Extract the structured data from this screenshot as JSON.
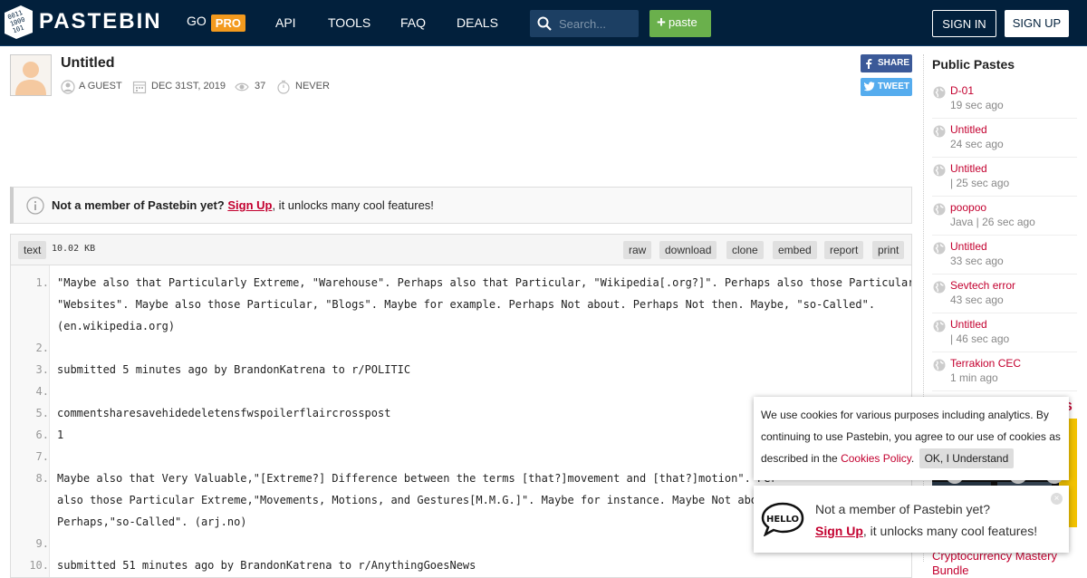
{
  "header": {
    "brand": "PASTEBIN",
    "nav": {
      "go": "GO",
      "pro": "PRO",
      "api": "API",
      "tools": "TOOLS",
      "faq": "FAQ",
      "deals": "DEALS"
    },
    "search_placeholder": "Search...",
    "paste_label": "paste",
    "sign_in": "SIGN IN",
    "sign_up": "SIGN UP"
  },
  "paste": {
    "title": "Untitled",
    "author": "A GUEST",
    "date": "DEC 31ST, 2019",
    "views": "37",
    "expires": "NEVER",
    "share": "SHARE",
    "tweet": "TWEET"
  },
  "notice": {
    "lead": "Not a member of Pastebin yet?",
    "link": "Sign Up",
    "rest": ", it unlocks many cool features!"
  },
  "code": {
    "syntax": "text",
    "size": "10.02 KB",
    "actions": [
      "raw",
      "download",
      "clone",
      "embed",
      "report",
      "print"
    ],
    "lines": [
      {
        "n": "1.",
        "text": "\"Maybe also that Particularly Extreme, \"Warehouse\". Perhaps also that Particular, \"Wikipedia[.org?]\". Perhaps also those Particular,"
      },
      {
        "n": "",
        "text": "\"Websites\". Maybe also those Particular, \"Blogs\". Maybe for example. Perhaps Not about. Perhaps Not then. Maybe, \"so-Called\"."
      },
      {
        "n": "",
        "text": "(en.wikipedia.org)"
      },
      {
        "n": "2.",
        "text": ""
      },
      {
        "n": "3.",
        "text": "submitted 5 minutes ago by BrandonKatrena to r/POLITIC"
      },
      {
        "n": "4.",
        "text": ""
      },
      {
        "n": "5.",
        "text": "commentsharesavehidedeletensfwspoilerflaircrosspost"
      },
      {
        "n": "6.",
        "text": "1"
      },
      {
        "n": "7.",
        "text": ""
      },
      {
        "n": "8.",
        "text": "Maybe also that Very Valuable,\"[Extreme?] Difference between the terms [that?]movement and [that?]motion\". Per"
      },
      {
        "n": "",
        "text": "also those Particular Extreme,\"Movements, Motions, and Gestures[M.M.G.]\". Maybe for instance. Maybe Not about."
      },
      {
        "n": "",
        "text": "Perhaps,\"so-Called\". (arj.no)"
      },
      {
        "n": "9.",
        "text": ""
      },
      {
        "n": "10.",
        "text": "submitted 51 minutes ago by BrandonKatrena to r/AnythingGoesNews"
      }
    ]
  },
  "sidebar": {
    "title": "Public Pastes",
    "items": [
      {
        "title": "D-01",
        "sub": "19 sec ago"
      },
      {
        "title": "Untitled",
        "sub": "24 sec ago"
      },
      {
        "title": "Untitled",
        "sub": "| 25 sec ago"
      },
      {
        "title": "poopoo",
        "sub": "Java | 26 sec ago"
      },
      {
        "title": "Untitled",
        "sub": "33 sec ago"
      },
      {
        "title": "Sevtech error",
        "sub": "43 sec ago"
      },
      {
        "title": "Untitled",
        "sub": "| 46 sec ago"
      },
      {
        "title": "Terrakion CEC",
        "sub": "1 min ago"
      }
    ],
    "fragment": "S",
    "ad_text": "Cryptocurrency Mastery Bundle"
  },
  "cookie": {
    "text": "We use cookies for various purposes including analytics. By continuing to use Pastebin, you agree to our use of cookies as described in the",
    "link": "Cookies Policy",
    "ok": "OK, I Understand"
  },
  "hello": {
    "line1": "Not a member of Pastebin yet?",
    "link": "Sign Up",
    "rest": ", it unlocks many cool features!",
    "close": "×"
  },
  "colors": {
    "header_bg": "#02203c",
    "pro": "#f39a1e",
    "paste_btn": "#6ab04c",
    "link_red": "#c3002f"
  }
}
